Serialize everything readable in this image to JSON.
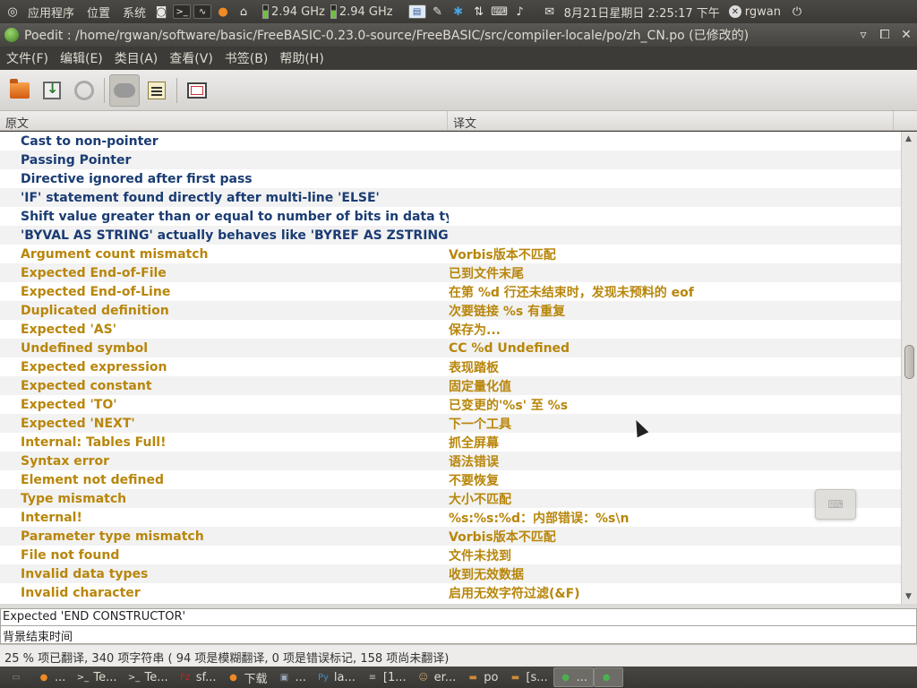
{
  "top_panel": {
    "menus": [
      "应用程序",
      "位置",
      "系统"
    ],
    "cpu1": "2.94 GHz",
    "cpu2": "2.94 GHz",
    "clock": "8月21日星期日 2:25:17 下午",
    "user": "rgwan"
  },
  "window": {
    "title": "Poedit : /home/rgwan/software/basic/FreeBASIC-0.23.0-source/FreeBASIC/src/compiler-locale/po/zh_CN.po (已修改的)"
  },
  "menubar": {
    "items": [
      "文件(F)",
      "编辑(E)",
      "类目(A)",
      "查看(V)",
      "书签(B)",
      "帮助(H)"
    ]
  },
  "toolbar": {
    "buttons": [
      "open-icon",
      "save-icon",
      "update-icon",
      "auto-translate-icon",
      "comment-icon",
      "fullscreen-icon"
    ]
  },
  "list": {
    "headers": {
      "source": "原文",
      "translation": "译文"
    },
    "rows": [
      {
        "src": "Cast to non-pointer",
        "trn": "",
        "state": "untranslated"
      },
      {
        "src": "Passing Pointer",
        "trn": "",
        "state": "untranslated"
      },
      {
        "src": "Directive ignored after first pass",
        "trn": "",
        "state": "untranslated"
      },
      {
        "src": "'IF' statement found directly after multi-line 'ELSE'",
        "trn": "",
        "state": "untranslated"
      },
      {
        "src": "Shift value greater than or equal to number of bits in data type",
        "trn": "",
        "state": "untranslated"
      },
      {
        "src": "'BYVAL AS STRING' actually behaves like 'BYREF AS ZSTRING' (...",
        "trn": "",
        "state": "untranslated"
      },
      {
        "src": "Argument count mismatch",
        "trn": "Vorbis版本不匹配",
        "state": "fuzzy"
      },
      {
        "src": "Expected End-of-File",
        "trn": "已到文件末尾",
        "state": "fuzzy"
      },
      {
        "src": "Expected End-of-Line",
        "trn": "在第 %d 行还未结束时，发现未预料的 eof",
        "state": "fuzzy"
      },
      {
        "src": "Duplicated definition",
        "trn": "次要链接 %s 有重复",
        "state": "fuzzy"
      },
      {
        "src": "Expected 'AS'",
        "trn": "保存为...",
        "state": "fuzzy"
      },
      {
        "src": "Undefined symbol",
        "trn": "CC %d Undefined",
        "state": "fuzzy"
      },
      {
        "src": "Expected expression",
        "trn": "表现踏板",
        "state": "fuzzy"
      },
      {
        "src": "Expected constant",
        "trn": "固定量化值",
        "state": "fuzzy"
      },
      {
        "src": "Expected 'TO'",
        "trn": "已变更的'%s' 至 %s",
        "state": "fuzzy"
      },
      {
        "src": "Expected 'NEXT'",
        "trn": "下一个工具",
        "state": "fuzzy"
      },
      {
        "src": "Internal: Tables Full!",
        "trn": "抓全屏幕",
        "state": "fuzzy"
      },
      {
        "src": "Syntax error",
        "trn": "语法错误",
        "state": "fuzzy"
      },
      {
        "src": "Element not defined",
        "trn": "不要恢复",
        "state": "fuzzy"
      },
      {
        "src": "Type mismatch",
        "trn": "大小不匹配",
        "state": "fuzzy"
      },
      {
        "src": "Internal!",
        "trn": "%s:%s:%d：内部错误：%s\\n",
        "state": "fuzzy"
      },
      {
        "src": "Parameter type mismatch",
        "trn": "Vorbis版本不匹配",
        "state": "fuzzy"
      },
      {
        "src": "File not found",
        "trn": "文件未找到",
        "state": "fuzzy"
      },
      {
        "src": "Invalid data types",
        "trn": "收到无效数据",
        "state": "fuzzy"
      },
      {
        "src": "Invalid character",
        "trn": "启用无效字符过滤(&F)",
        "state": "fuzzy"
      }
    ]
  },
  "editor": {
    "source_text": "Expected 'END CONSTRUCTOR'",
    "translation_text": "背景结束时间"
  },
  "statusbar": {
    "text": "25 % 项已翻译, 340 项字符串 ( 94 项是模糊翻译, 0 项是错误标记, 158 项尚未翻译)"
  },
  "taskbar": {
    "tasks": [
      {
        "label": "...",
        "icon": "firefox-icon"
      },
      {
        "label": "Te...",
        "icon": "terminal-icon"
      },
      {
        "label": "Te...",
        "icon": "terminal-icon"
      },
      {
        "label": "sf...",
        "icon": "filezilla-icon"
      },
      {
        "label": "下载",
        "icon": "firefox-icon"
      },
      {
        "label": "...",
        "icon": "package-icon"
      },
      {
        "label": "la...",
        "icon": "python-icon"
      },
      {
        "label": "[1...",
        "icon": "script-icon"
      },
      {
        "label": "er...",
        "icon": "gimp-icon"
      },
      {
        "label": "po",
        "icon": "folder-icon"
      },
      {
        "label": "[s...",
        "icon": "folder-icon"
      },
      {
        "label": "...",
        "icon": "poedit-icon"
      },
      {
        "label": "",
        "icon": "poedit-icon"
      }
    ]
  },
  "colors": {
    "untranslated": "#1a3c73",
    "fuzzy": "#b8860b",
    "panel": "#3c3b37"
  }
}
